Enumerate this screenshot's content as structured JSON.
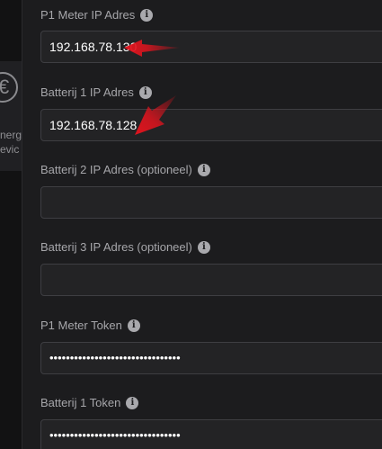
{
  "background": {
    "card_text_line1": "nerg",
    "card_text_line2": "evic",
    "euro_icon": "€"
  },
  "form": {
    "fields": [
      {
        "label": "P1 Meter IP Adres",
        "value": "192.168.78.130",
        "type": "text"
      },
      {
        "label": "Batterij 1 IP Adres",
        "value": "192.168.78.128",
        "type": "text"
      },
      {
        "label": "Batterij 2 IP Adres (optioneel)",
        "value": "",
        "type": "text"
      },
      {
        "label": "Batterij 3 IP Adres (optioneel)",
        "value": "",
        "type": "text"
      },
      {
        "label": "P1 Meter Token",
        "value": "••••••••••••••••••••••••••••••••",
        "type": "password"
      },
      {
        "label": "Batterij 1 Token",
        "value": "••••••••••••••••••••••••••••••••",
        "type": "password"
      }
    ],
    "info_icon": "i"
  },
  "colors": {
    "arrow": "#e0141e",
    "panel_bg": "#1c1c1e",
    "input_border": "#3e3e42"
  }
}
